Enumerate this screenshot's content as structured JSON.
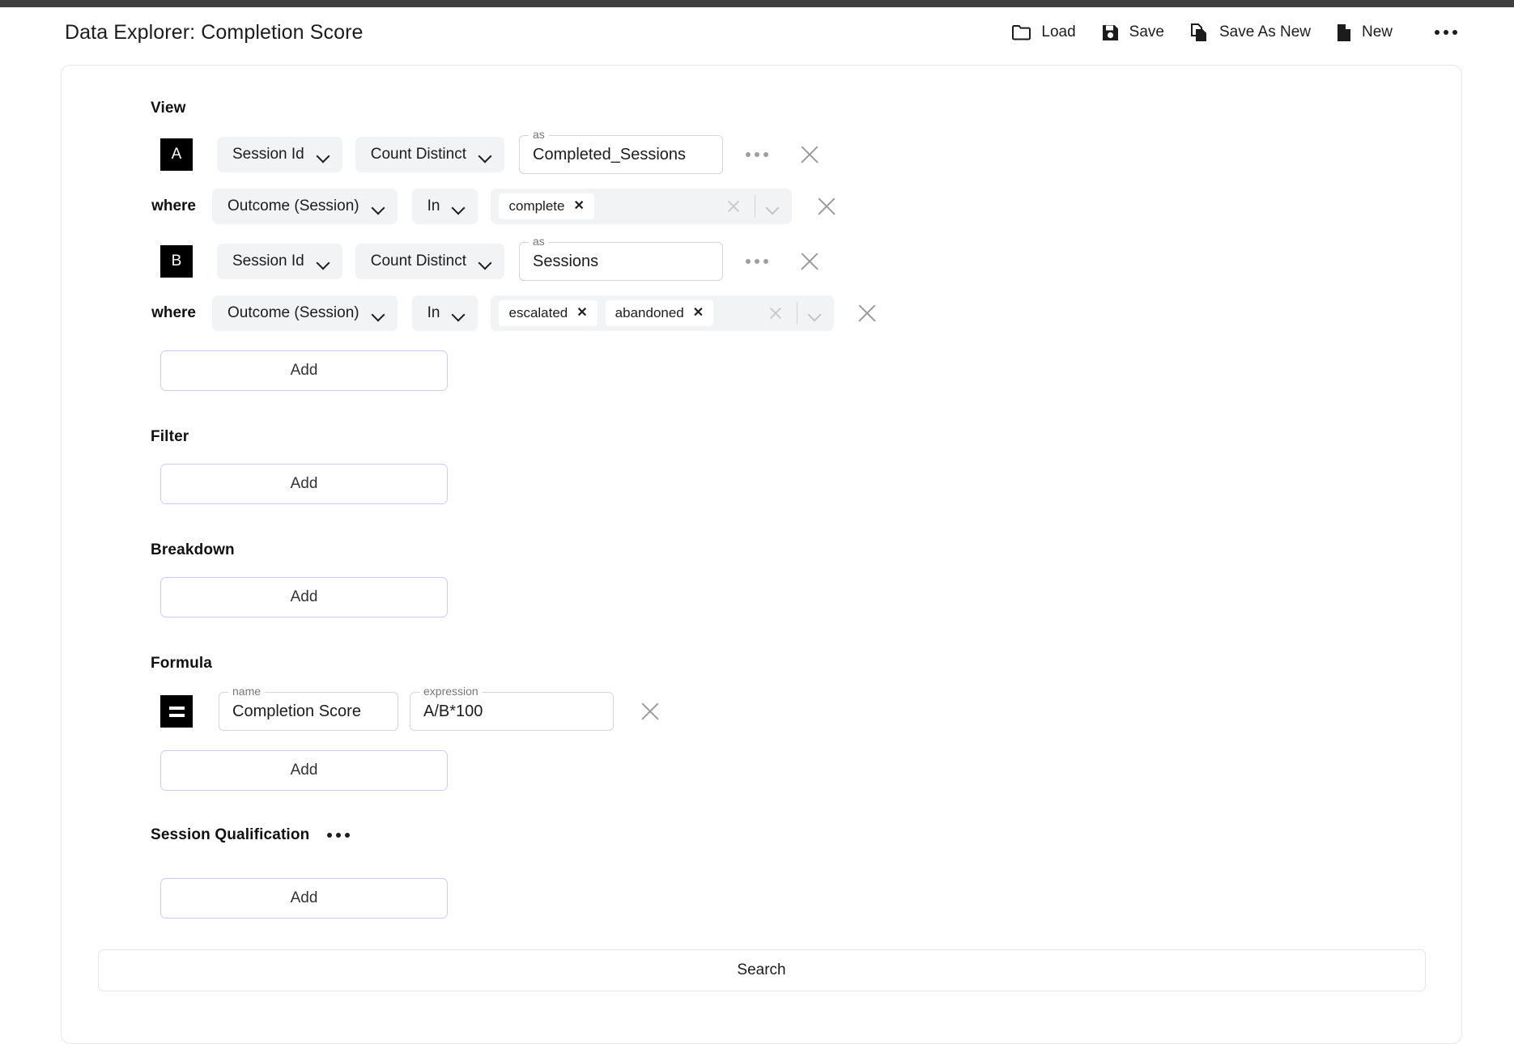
{
  "header": {
    "title": "Data Explorer: Completion Score",
    "actions": [
      {
        "label": "Load",
        "icon": "folder-icon"
      },
      {
        "label": "Save",
        "icon": "floppy-disk-icon"
      },
      {
        "label": "Save As New",
        "icon": "copy-document-icon"
      },
      {
        "label": "New",
        "icon": "document-icon"
      }
    ],
    "more_icon": "overflow-menu-icon"
  },
  "sections": {
    "view": {
      "label": "View",
      "add_label": "Add",
      "rows": [
        {
          "badge": "A",
          "field": "Session Id",
          "aggregation": "Count Distinct",
          "as_legend": "as",
          "as_value": "Completed_Sessions",
          "where": {
            "label": "where",
            "field": "Outcome (Session)",
            "operator": "In",
            "tags": [
              "complete"
            ]
          }
        },
        {
          "badge": "B",
          "field": "Session Id",
          "aggregation": "Count Distinct",
          "as_legend": "as",
          "as_value": "Sessions",
          "where": {
            "label": "where",
            "field": "Outcome (Session)",
            "operator": "In",
            "tags": [
              "escalated",
              "abandoned"
            ]
          }
        }
      ]
    },
    "filter": {
      "label": "Filter",
      "add_label": "Add"
    },
    "breakdown": {
      "label": "Breakdown",
      "add_label": "Add"
    },
    "formula": {
      "label": "Formula",
      "add_label": "Add",
      "rows": [
        {
          "name_legend": "name",
          "name_value": "Completion Score",
          "expression_legend": "expression",
          "expression_value": "A/B*100"
        }
      ]
    },
    "session_qualification": {
      "label": "Session Qualification",
      "add_label": "Add",
      "more_icon": "overflow-menu-icon"
    }
  },
  "search_button": {
    "label": "Search"
  },
  "colors": {
    "top_strip": "#3f3f3f",
    "badge_background": "#000000",
    "add_button_border": "#cfcbf3",
    "select_background": "#f2f3f5"
  }
}
